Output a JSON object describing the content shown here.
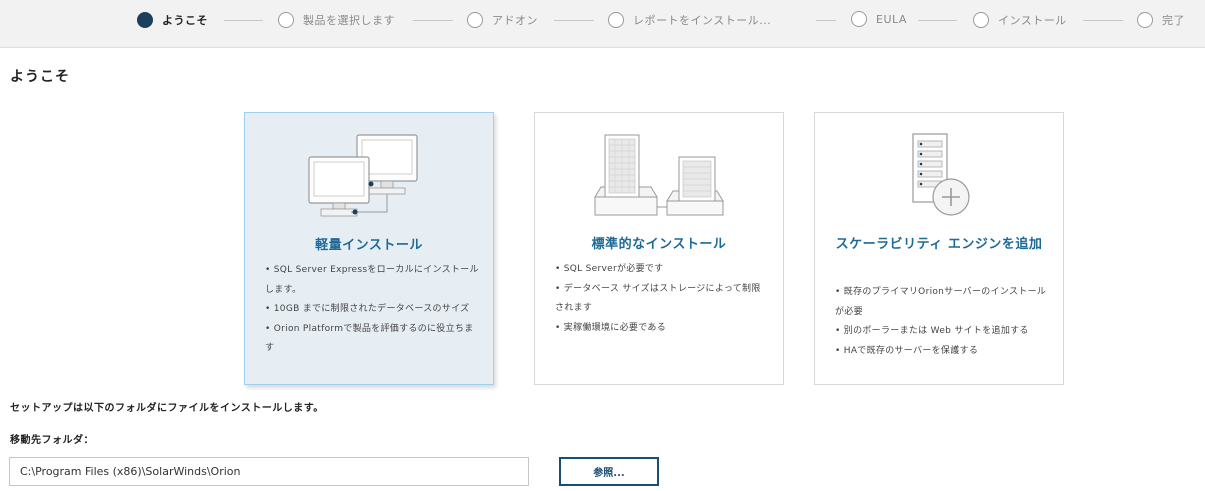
{
  "stepper": {
    "steps": [
      {
        "label": "ようこそ",
        "active": true
      },
      {
        "label": "製品を選択します",
        "active": false
      },
      {
        "label": "アドオン",
        "active": false
      },
      {
        "label": "レポートをインストール...",
        "active": false
      },
      {
        "label": "EULA",
        "active": false
      },
      {
        "label": "インストール",
        "active": false
      },
      {
        "label": "完了",
        "active": false
      }
    ]
  },
  "page": {
    "title": "ようこそ"
  },
  "cards": [
    {
      "title": "軽量インストール",
      "selected": true,
      "bullets": [
        "SQL Server Expressをローカルにインストールします。",
        "10GB までに制限されたデータベースのサイズ",
        "Orion Platformで製品を評価するのに役立ちます"
      ]
    },
    {
      "title": "標準的なインストール",
      "selected": false,
      "bullets": [
        "SQL Serverが必要です",
        "データベース サイズはストレージによって制限されます",
        "実稼働環境に必要である"
      ]
    },
    {
      "title": "スケーラビリティ エンジンを追加",
      "selected": false,
      "bullets": [
        "既存のプライマリOrionサーバーのインストールが必要",
        "別のポーラーまたは Web サイトを追加する",
        "HAで既存のサーバーを保護する"
      ]
    }
  ],
  "footer": {
    "info": "セットアップは以下のフォルダにファイルをインストールします。",
    "dest_label": "移動先フォルダ：",
    "path_value": "C:\\Program Files (x86)\\SolarWinds\\Orion",
    "browse_label": "参照..."
  },
  "colors": {
    "accent": "#1e6a96",
    "active_step": "#1b3f5c",
    "selected_card_bg": "#e6edf3",
    "selected_card_border": "#9fd0ef"
  },
  "icons": {
    "card0": "desktop-computers-icon",
    "card1": "server-buildings-icon",
    "card2": "add-server-icon"
  }
}
